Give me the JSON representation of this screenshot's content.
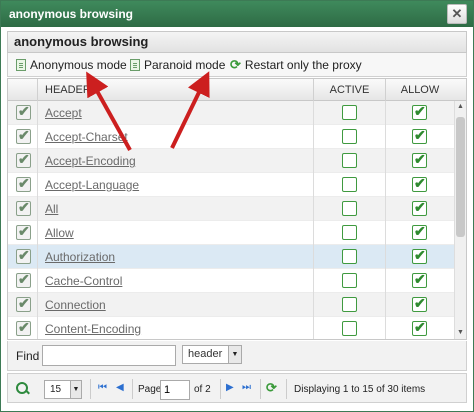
{
  "window": {
    "title": "anonymous browsing",
    "close_glyph": "✕"
  },
  "panel": {
    "title": "anonymous browsing"
  },
  "toolbar": {
    "anonymous_label": "Anonymous mode",
    "paranoid_label": "Paranoid mode",
    "restart_label": "Restart only the proxy",
    "doc_icon": "document-icon",
    "restart_icon": "refresh-icon"
  },
  "grid": {
    "columns": {
      "header": "HEADER",
      "active": "ACTIVE",
      "allow": "ALLOW"
    },
    "rows": [
      {
        "name": "Accept",
        "selected": true,
        "active": false,
        "allow": true
      },
      {
        "name": "Accept-Charset",
        "selected": true,
        "active": false,
        "allow": true
      },
      {
        "name": "Accept-Encoding",
        "selected": true,
        "active": false,
        "allow": true
      },
      {
        "name": "Accept-Language",
        "selected": true,
        "active": false,
        "allow": true
      },
      {
        "name": "All",
        "selected": true,
        "active": false,
        "allow": true
      },
      {
        "name": "Allow",
        "selected": true,
        "active": false,
        "allow": true
      },
      {
        "name": "Authorization",
        "selected": true,
        "active": false,
        "allow": true,
        "highlight": true
      },
      {
        "name": "Cache-Control",
        "selected": true,
        "active": false,
        "allow": true
      },
      {
        "name": "Connection",
        "selected": true,
        "active": false,
        "allow": true
      },
      {
        "name": "Content-Encoding",
        "selected": true,
        "active": false,
        "allow": true
      }
    ]
  },
  "find": {
    "label": "Find",
    "value": "",
    "field": "header"
  },
  "pager": {
    "page_size": "15",
    "page_label": "Page",
    "page": "1",
    "of_label": "of 2",
    "status": "Displaying 1 to 15 of 30 items"
  },
  "colors": {
    "title_bar": "#3f8a5c",
    "check": "#2f8a2f",
    "arrow": "#cc1f1f",
    "selected_row": "#dbe9f4"
  }
}
